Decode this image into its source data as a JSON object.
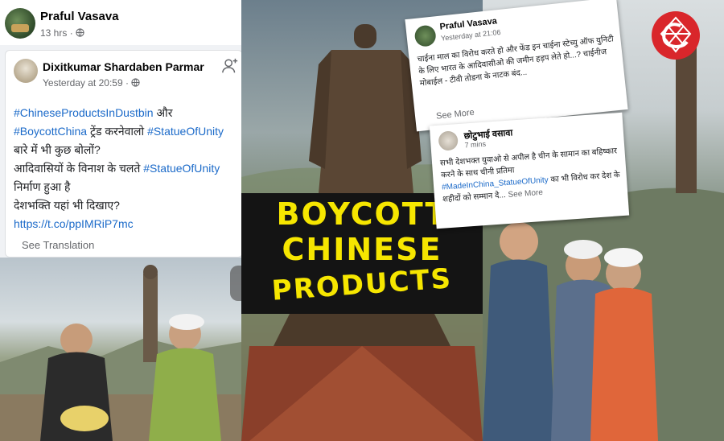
{
  "main_post": {
    "author": "Praful Vasava",
    "time": "13 hrs",
    "privacy_icon": "globe-icon",
    "more_icon": "more-dots"
  },
  "shared_post": {
    "author": "Dixitkumar Shardaben Parmar",
    "time": "Yesterday at 20:59",
    "follow_icon": "add-friend-icon",
    "text": {
      "tag1": "#ChineseProductsInDustbin",
      "and": " और",
      "tag2": "#BoycottChina",
      "mid1": " ट्रेंड करनेवालो ",
      "tag3": "#StatueOfUnity",
      "line3": "बारे में भी कुछ बोलों?",
      "line4": "आदिवासियों के विनाश के चलते ",
      "tag4": "#StatueOfUnity",
      "line5": "निर्माण हुआ है",
      "line6": " देशभक्ति यहां भी दिखाए?",
      "link": "https://t.co/ppIMRiP7mc"
    },
    "see_translation": "See Translation"
  },
  "headline": {
    "line1": "BOYCOTT",
    "line2": "CHINESE",
    "line3": "PRODUCTS",
    "color": "#f6e600"
  },
  "inset_post_1": {
    "author": "Praful Vasava",
    "time": "Yesterday at 21:06",
    "text": "चाईना माल का विरोध करते हो और फेंड इन चाईना स्टेच्यु ऑफ युनिटी के लिए भारत के आदिवासीओ की जमीन हड़प लेते हो...? चाईनीज मोबाईल - टीवी तोडना के नाटक बंद...",
    "see_more": "See More"
  },
  "inset_post_2": {
    "author": "छोटुभाई वसावा",
    "time": "7 mins",
    "text_a": "सभी देशभक्त युवाओ से अपील है चीन के सामान का बहिष्कार करने के साथ चीनी प्रतिमा",
    "tag": "#MadeInChina_StatueOfUnity",
    "text_b": " का भी विरोध कर देश के शहीदों को सम्मान दे...",
    "see_more": " See More"
  },
  "logo": {
    "icon": "e-globe-logo",
    "color": "#d9262b"
  }
}
